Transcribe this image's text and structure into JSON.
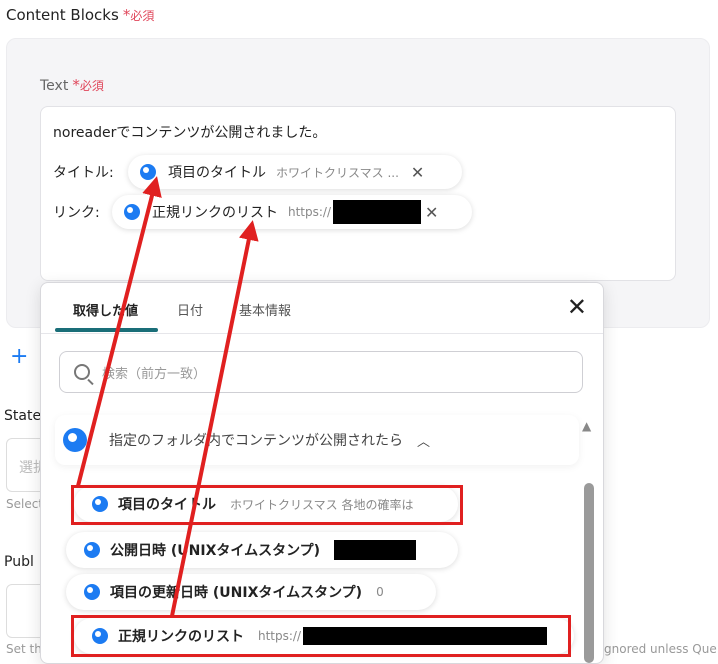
{
  "content_blocks": {
    "title": "Content Blocks",
    "required_mark": "*",
    "required_label": "必須"
  },
  "text_field": {
    "label": "Text",
    "required_mark": "*",
    "required_label": "必須",
    "first_line": "noreaderでコンテンツが公開されました。",
    "title_row": {
      "label": "タイトル:",
      "chip_name": "項目のタイトル",
      "chip_preview": "ホワイトクリスマス ..."
    },
    "link_row": {
      "label": "リンク:",
      "chip_name": "正規リンクのリスト",
      "chip_preview": "https://"
    }
  },
  "behind": {
    "state_label": "State",
    "state_placeholder": "選択",
    "state_hint": "Select",
    "public_label": "Publ",
    "public_hint": "Set th",
    "right_hint": "gnored unless Que"
  },
  "dropdown": {
    "tabs": [
      {
        "label": "取得した値",
        "active": true
      },
      {
        "label": "日付",
        "active": false
      },
      {
        "label": "基本情報",
        "active": false
      }
    ],
    "search_placeholder": "検索（前方一致）",
    "group_title": "指定のフォルダ内でコンテンツが公開されたら",
    "options": [
      {
        "name": "項目のタイトル",
        "preview": "ホワイトクリスマス 各地の確率は",
        "highlighted": true
      },
      {
        "name": "公開日時 (UNIXタイムスタンプ)",
        "preview": "",
        "redacted": true
      },
      {
        "name": "項目の更新日時 (UNIXタイムスタンプ)",
        "preview": "0"
      },
      {
        "name": "正規リンクのリスト",
        "preview": "https://",
        "redacted": true,
        "highlighted": true
      }
    ]
  },
  "icons": {
    "variable_dot": "blue-circle-icon",
    "remove": "close-icon",
    "search": "search-icon",
    "collapse": "chevron-up-icon",
    "add": "plus-icon"
  },
  "colors": {
    "accent_blue": "#1c7bf2",
    "required_red": "#e0475b",
    "annotation_red": "#e02020",
    "tab_underline": "#1a6e78"
  }
}
